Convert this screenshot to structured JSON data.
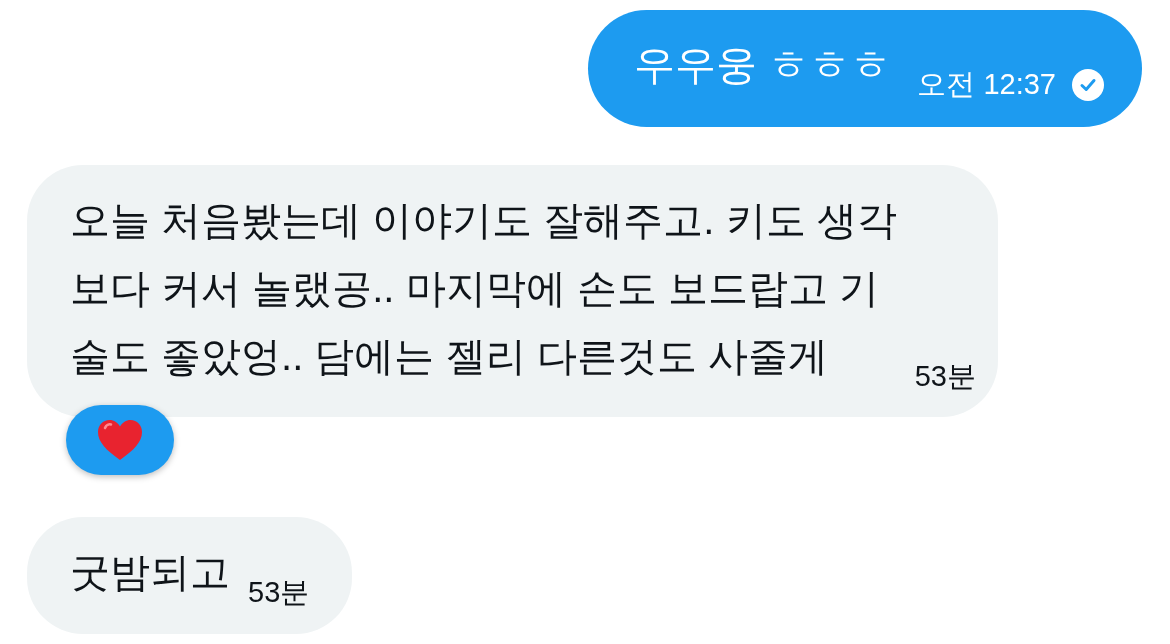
{
  "messages": [
    {
      "kind": "sent",
      "lines": [
        "우우웅 ㅎㅎㅎ"
      ],
      "time": "오전 12:37",
      "read": true,
      "reacted": false
    },
    {
      "kind": "received",
      "lines": [
        "오늘 처음봤는데 이야기도 잘해주고. 키도 생각",
        "보다 커서 놀랬공.. 마지막에 손도 보드랍고 기",
        "술도 좋았엉.. 담에는 젤리 다른것도 사줄게"
      ],
      "time": "53분",
      "read": false,
      "reacted": true
    },
    {
      "kind": "received",
      "lines": [
        "굿밤되고"
      ],
      "time": "53분",
      "read": false,
      "reacted": false
    }
  ]
}
